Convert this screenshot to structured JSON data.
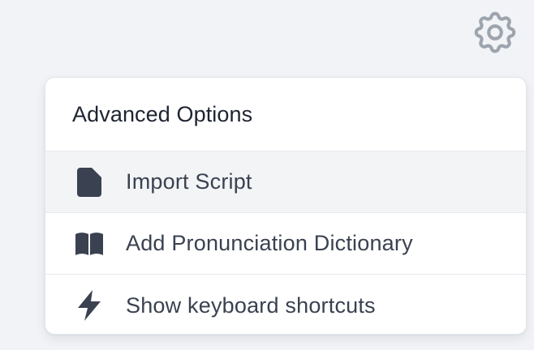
{
  "settings": {
    "icon": "gear-icon",
    "icon_color": "#9ea4ad"
  },
  "menu": {
    "title": "Advanced Options",
    "items": [
      {
        "label": "Import Script",
        "icon": "document-icon",
        "active": true
      },
      {
        "label": "Add Pronunciation Dictionary",
        "icon": "book-icon",
        "active": false
      },
      {
        "label": "Show keyboard shortcuts",
        "icon": "lightning-icon",
        "active": false
      }
    ]
  },
  "colors": {
    "background": "#f1f3f6",
    "menu_background": "#ffffff",
    "active_row": "#f3f4f6",
    "icon_dark": "#3a4150",
    "title_text": "#1e2430",
    "item_text": "#3a4150"
  }
}
